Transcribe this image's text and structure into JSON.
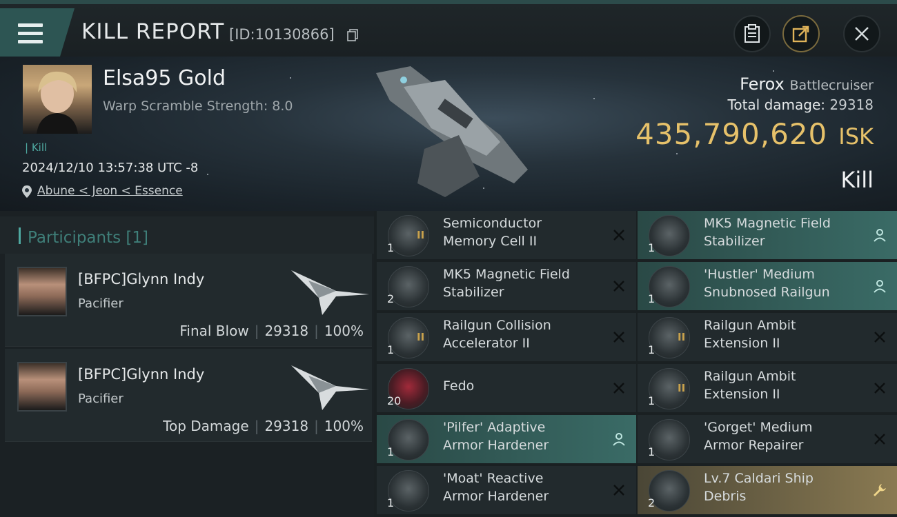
{
  "header": {
    "title": "KILL REPORT",
    "report_id": "[ID:10130866]"
  },
  "victim": {
    "name": "Elsa95 Gold",
    "warp_scramble": "Warp Scramble Strength: 8.0",
    "kill_tag": "Kill",
    "datetime": "2024/12/10 13:57:38 UTC -8",
    "location": "Abune < Jeon < Essence",
    "ship_name": "Ferox",
    "ship_class": "Battlecruiser",
    "total_damage_label": "Total damage:",
    "total_damage": "29318",
    "isk_value": "435,790,620",
    "isk_unit": "ISK",
    "result": "Kill"
  },
  "participants": {
    "title": "Participants",
    "count": "[1]",
    "list": [
      {
        "name": "[BFPC]Glynn Indy",
        "ship": "Pacifier",
        "role": "Final Blow",
        "damage": "29318",
        "percent": "100%"
      },
      {
        "name": "[BFPC]Glynn Indy",
        "ship": "Pacifier",
        "role": "Top Damage",
        "damage": "29318",
        "percent": "100%"
      }
    ]
  },
  "items": [
    {
      "name1": "Semiconductor",
      "name2": "Memory Cell II",
      "qty": "1",
      "meta": "II",
      "state": "dropped",
      "action": "close-icon"
    },
    {
      "name1": "MK5 Magnetic Field",
      "name2": "Stabilizer",
      "qty": "1",
      "meta": "",
      "state": "equipped",
      "action": "person-icon"
    },
    {
      "name1": "MK5 Magnetic Field",
      "name2": "Stabilizer",
      "qty": "2",
      "meta": "",
      "state": "dropped",
      "action": "close-icon"
    },
    {
      "name1": "'Hustler' Medium",
      "name2": "Snubnosed Railgun",
      "qty": "1",
      "meta": "",
      "state": "equipped",
      "action": "person-icon"
    },
    {
      "name1": "Railgun Collision",
      "name2": "Accelerator II",
      "qty": "1",
      "meta": "II",
      "state": "dropped",
      "action": "close-icon"
    },
    {
      "name1": "Railgun Ambit",
      "name2": "Extension II",
      "qty": "1",
      "meta": "II",
      "state": "dropped",
      "action": "close-icon"
    },
    {
      "name1": "Fedo",
      "name2": "",
      "qty": "20",
      "meta": "",
      "state": "dropped",
      "action": "close-icon"
    },
    {
      "name1": "Railgun Ambit",
      "name2": "Extension II",
      "qty": "1",
      "meta": "II",
      "state": "dropped",
      "action": "close-icon"
    },
    {
      "name1": "'Pilfer' Adaptive",
      "name2": "Armor Hardener",
      "qty": "1",
      "meta": "",
      "state": "equipped",
      "action": "person-icon"
    },
    {
      "name1": "'Gorget' Medium",
      "name2": "Armor Repairer",
      "qty": "1",
      "meta": "",
      "state": "dropped",
      "action": "close-icon"
    },
    {
      "name1": "'Moat' Reactive",
      "name2": "Armor Hardener",
      "qty": "1",
      "meta": "",
      "state": "dropped",
      "action": "close-icon"
    },
    {
      "name1": "Lv.7 Caldari Ship",
      "name2": "Debris",
      "qty": "2",
      "meta": "",
      "state": "salvage",
      "action": "wrench-icon"
    }
  ],
  "colors": {
    "accent": "#4fa9a1",
    "isk_gold": "#e6c16a",
    "equipped_bg": "#3a6b66",
    "salvage_bg": "#8a7a52"
  }
}
